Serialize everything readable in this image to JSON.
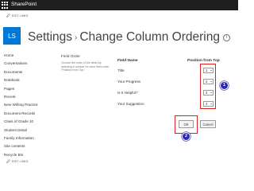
{
  "header": {
    "brand": "SharePoint"
  },
  "edit_links_label": "EDIT LINKS",
  "site": {
    "initials": "LS"
  },
  "page": {
    "title_part1": "Settings",
    "separator": "›",
    "title_part2": "Change Column Ordering",
    "info_glyph": "i"
  },
  "nav": {
    "items": [
      "Home",
      "Conversations",
      "Documents",
      "Notebook",
      "Pages",
      "Recent",
      "New Writing Practice",
      "Document Records",
      "Class of Grade 10",
      "Student Detail",
      "Family Information",
      "Site contents",
      "Recycle Bin"
    ]
  },
  "field_order": {
    "title": "Field Order",
    "description": "Choose the order of the fields by selecting a number for each field under \"Position from Top\"."
  },
  "table": {
    "field_name_header": "Field Name",
    "position_header": "Position from Top",
    "rows": [
      {
        "field": "Title",
        "position": "1"
      },
      {
        "field": "Your Progress",
        "position": "2"
      },
      {
        "field": "Is It Helpful?",
        "position": "3"
      },
      {
        "field": "Your Suggestion",
        "position": "4"
      }
    ]
  },
  "buttons": {
    "ok": "OK",
    "cancel": "Cancel"
  },
  "callouts": {
    "one": "1",
    "two": "2"
  },
  "colors": {
    "topbar": "#1e1e1e",
    "site_tile": "#0078d7",
    "highlight": "#e02020",
    "callout_badge": "#2a2ab4"
  }
}
